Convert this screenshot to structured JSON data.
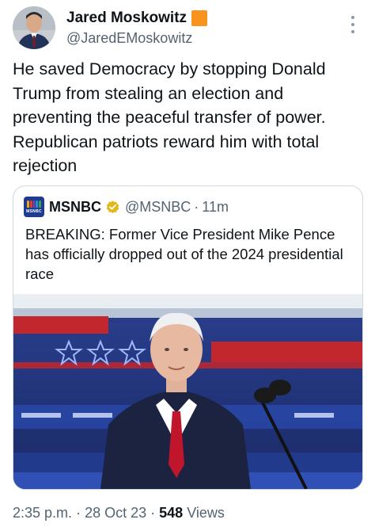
{
  "author": {
    "display_name": "Jared Moskowitz",
    "handle": "@JaredEMoskowitz",
    "badge_color": "#f7931e"
  },
  "tweet": {
    "text": "He saved Democracy by stopping Donald Trump from stealing an election and preventing the peaceful transfer of power. Republican patriots reward him with total rejection"
  },
  "quoted_tweet": {
    "avatar_text": "MSNBC",
    "name": "MSNBC",
    "verified_badge": "gold-check-icon",
    "handle": "@MSNBC",
    "separator": "·",
    "time": "11m",
    "text": "BREAKING: Former Vice President Mike Pence has officially dropped out of the 2024 presidential race",
    "media_description_icon": "photo"
  },
  "meta": {
    "time": "2:35 p.m.",
    "separator1": "·",
    "date": "28 Oct 23",
    "separator2": "·",
    "views_count": "548",
    "views_label": "Views"
  },
  "colors": {
    "text_primary": "#0f1419",
    "text_secondary": "#536471",
    "border": "#cfd9de",
    "brand_msnbc": "#1d3c8f"
  }
}
